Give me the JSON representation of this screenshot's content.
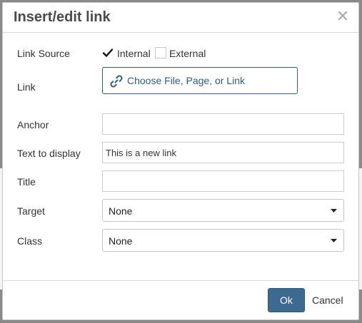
{
  "dialog": {
    "title": "Insert/edit link",
    "close_icon": "close-icon"
  },
  "form": {
    "link_source": {
      "label": "Link Source",
      "options": [
        {
          "label": "Internal",
          "checked": true
        },
        {
          "label": "External",
          "checked": false
        }
      ]
    },
    "link": {
      "label": "Link",
      "button_label": "Choose File, Page, or Link",
      "icon": "link-icon"
    },
    "anchor": {
      "label": "Anchor",
      "value": ""
    },
    "text_to_display": {
      "label": "Text to display",
      "value": "This is a new link"
    },
    "title": {
      "label": "Title",
      "value": ""
    },
    "target": {
      "label": "Target",
      "selected": "None"
    },
    "class": {
      "label": "Class",
      "selected": "None"
    }
  },
  "footer": {
    "ok_label": "Ok",
    "cancel_label": "Cancel"
  },
  "colors": {
    "accent": "#3d6a91",
    "link_text": "#2f5d7e",
    "overlay": "#8a8a8a"
  }
}
